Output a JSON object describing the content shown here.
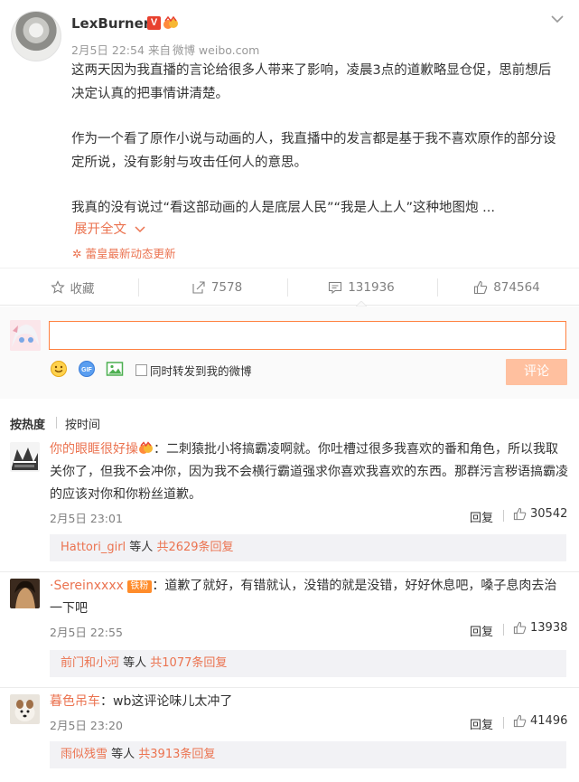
{
  "post": {
    "username": "LexBurner",
    "verified_badge": "V",
    "meta": {
      "date": "2月5日",
      "time": "22:54",
      "source_prefix": "来自",
      "source": "微博 weibo.com"
    },
    "paragraphs": [
      "这两天因为我直播的言论给很多人带来了影响，凌晨3点的道歉略显仓促，思前想后决定认真的把事情讲清楚。",
      "作为一个看了原作小说与动画的人，我直播中的发言都是基于我不喜欢原作的部分设定所说，没有影射与攻击任何人的意思。",
      "我真的没有说过“看这部动画的人是底层人民”“我是人上人”这种地图炮 ..."
    ],
    "expand_label": "展开全文",
    "update_label": "蕾皇最新动态更新"
  },
  "actions": {
    "favorite": "收藏",
    "repost": "7578",
    "comment": "131936",
    "like": "874564"
  },
  "compose": {
    "placeholder": "",
    "sync_label": "同时转发到我的微博",
    "submit_label": "评论"
  },
  "sort": {
    "hot": "按热度",
    "time": "按时间"
  },
  "comments": [
    {
      "name": "你的眼眶很好操",
      "text": "：二刺猿批小将搞霸凌啊就。你吐槽过很多我喜欢的番和角色，所以我取关你了，但我不会冲你，因为我不会横行霸道强求你喜欢我喜欢的东西。那群污言秽语搞霸凌的应该对你和你粉丝道歉。",
      "time": "2月5日 23:01",
      "reply": "回复",
      "likes": "30542",
      "sub_user": "Hattori_girl",
      "sub_mid": " 等人 ",
      "sub_count": "共2629条回复"
    },
    {
      "name": "·Sereinxxxx",
      "badge_text": "铁粉",
      "text": "：道歉了就好，有错就认，没错的就是没错，好好休息吧，嗓子息肉去治一下吧",
      "time": "2月5日 22:55",
      "reply": "回复",
      "likes": "13938",
      "sub_user": "前门和小河",
      "sub_mid": " 等人 ",
      "sub_count": "共1077条回复"
    },
    {
      "name": "暮色吊车",
      "text": "：wb这评论味儿太冲了",
      "time": "2月5日 23:20",
      "reply": "回复",
      "likes": "41496",
      "sub_user": "雨似残雪",
      "sub_mid": " 等人 ",
      "sub_count": "共3913条回复"
    }
  ],
  "colors": {
    "accent": "#eb7350",
    "input_border": "#ff8140",
    "submit_bg": "#ffc09f",
    "verified": "#e8412f"
  }
}
